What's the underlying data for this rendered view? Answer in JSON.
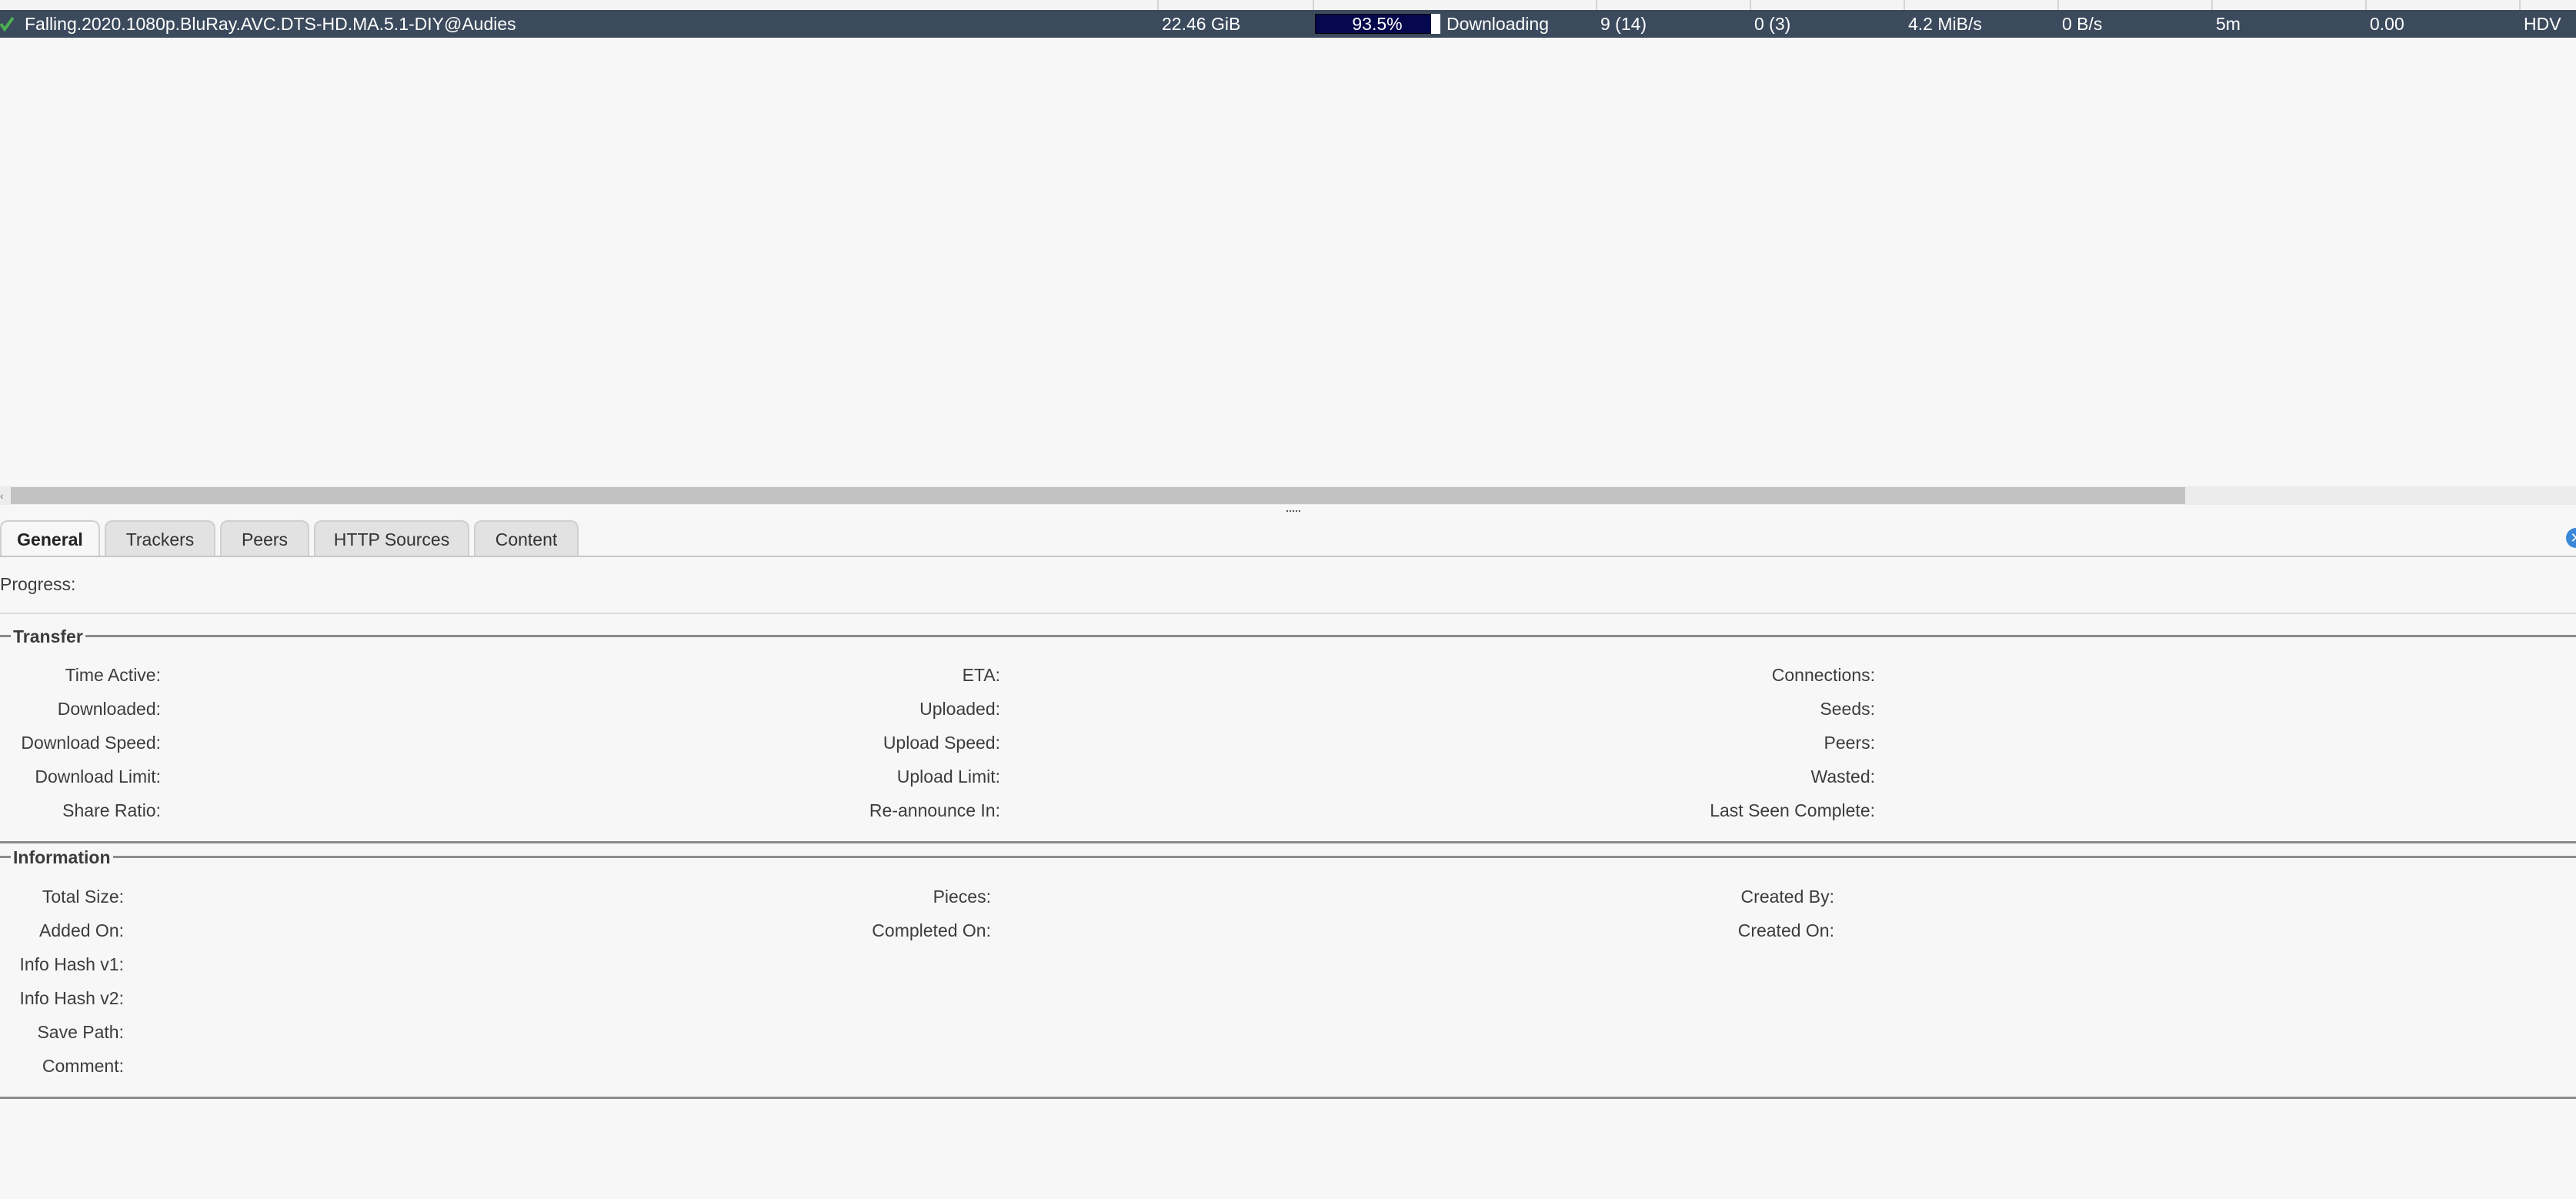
{
  "torrent_list": {
    "rows": [
      {
        "name": "Falling.2020.1080p.BluRay.AVC.DTS-HD.MA.5.1-DIY@Audies",
        "size": "22.46 GiB",
        "progress_text": "93.5%",
        "progress_value": 0.935,
        "status": "Downloading",
        "seeds": "9 (14)",
        "peers": "0 (3)",
        "down_speed": "4.2 MiB/s",
        "up_speed": "0 B/s",
        "eta": "5m",
        "ratio": "0.00",
        "category": "HDV"
      }
    ]
  },
  "tabs": [
    {
      "label": "General",
      "active": true
    },
    {
      "label": "Trackers",
      "active": false
    },
    {
      "label": "Peers",
      "active": false
    },
    {
      "label": "HTTP Sources",
      "active": false
    },
    {
      "label": "Content",
      "active": false
    }
  ],
  "general": {
    "progress_label": "Progress:",
    "transfer": {
      "title": "Transfer",
      "col1": [
        "Time Active:",
        "Downloaded:",
        "Download Speed:",
        "Download Limit:",
        "Share Ratio:"
      ],
      "col2": [
        "ETA:",
        "Uploaded:",
        "Upload Speed:",
        "Upload Limit:",
        "Re-announce In:"
      ],
      "col3": [
        "Connections:",
        "Seeds:",
        "Peers:",
        "Wasted:",
        "Last Seen Complete:"
      ]
    },
    "information": {
      "title": "Information",
      "col1": [
        "Total Size:",
        "Added On:",
        "Info Hash v1:",
        "Info Hash v2:",
        "Save Path:",
        "Comment:"
      ],
      "col2": [
        "Pieces:",
        "Completed On:"
      ],
      "col3": [
        "Created By:",
        "Created On:"
      ]
    }
  },
  "colors": {
    "row_selected_bg": "#3b4a5c",
    "progress_bar": "#0a0f5a",
    "close_button": "#3b88d8"
  }
}
